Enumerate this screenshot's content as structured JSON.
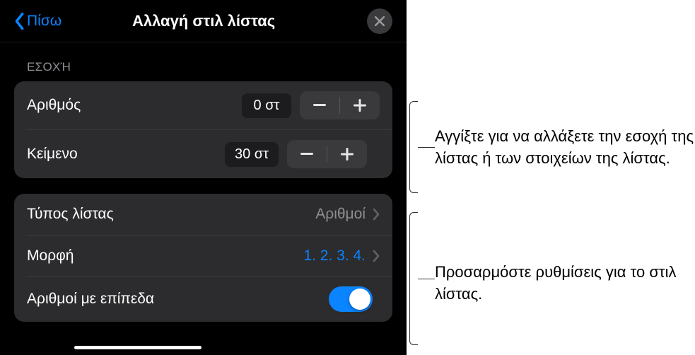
{
  "header": {
    "back_label": "Πίσω",
    "title": "Αλλαγή στιλ λίστας"
  },
  "section_indent": {
    "label": "ΕΣΟΧΉ",
    "rows": {
      "number": {
        "label": "Αριθμός",
        "value": "0 στ"
      },
      "text": {
        "label": "Κείμενο",
        "value": "30 στ"
      }
    }
  },
  "section_style": {
    "rows": {
      "list_type": {
        "label": "Τύπος λίστας",
        "detail": "Αριθμοί"
      },
      "format": {
        "label": "Μορφή",
        "detail": "1. 2. 3. 4."
      },
      "tiered": {
        "label": "Αριθμοί με επίπεδα",
        "on": true
      }
    }
  },
  "annotations": {
    "a1": "Αγγίξτε για να αλλάξετε την εσοχή της λίστας ή των στοιχείων της λίστας.",
    "a2": "Προσαρμόστε ρυθμίσεις για το στιλ λίστας."
  }
}
